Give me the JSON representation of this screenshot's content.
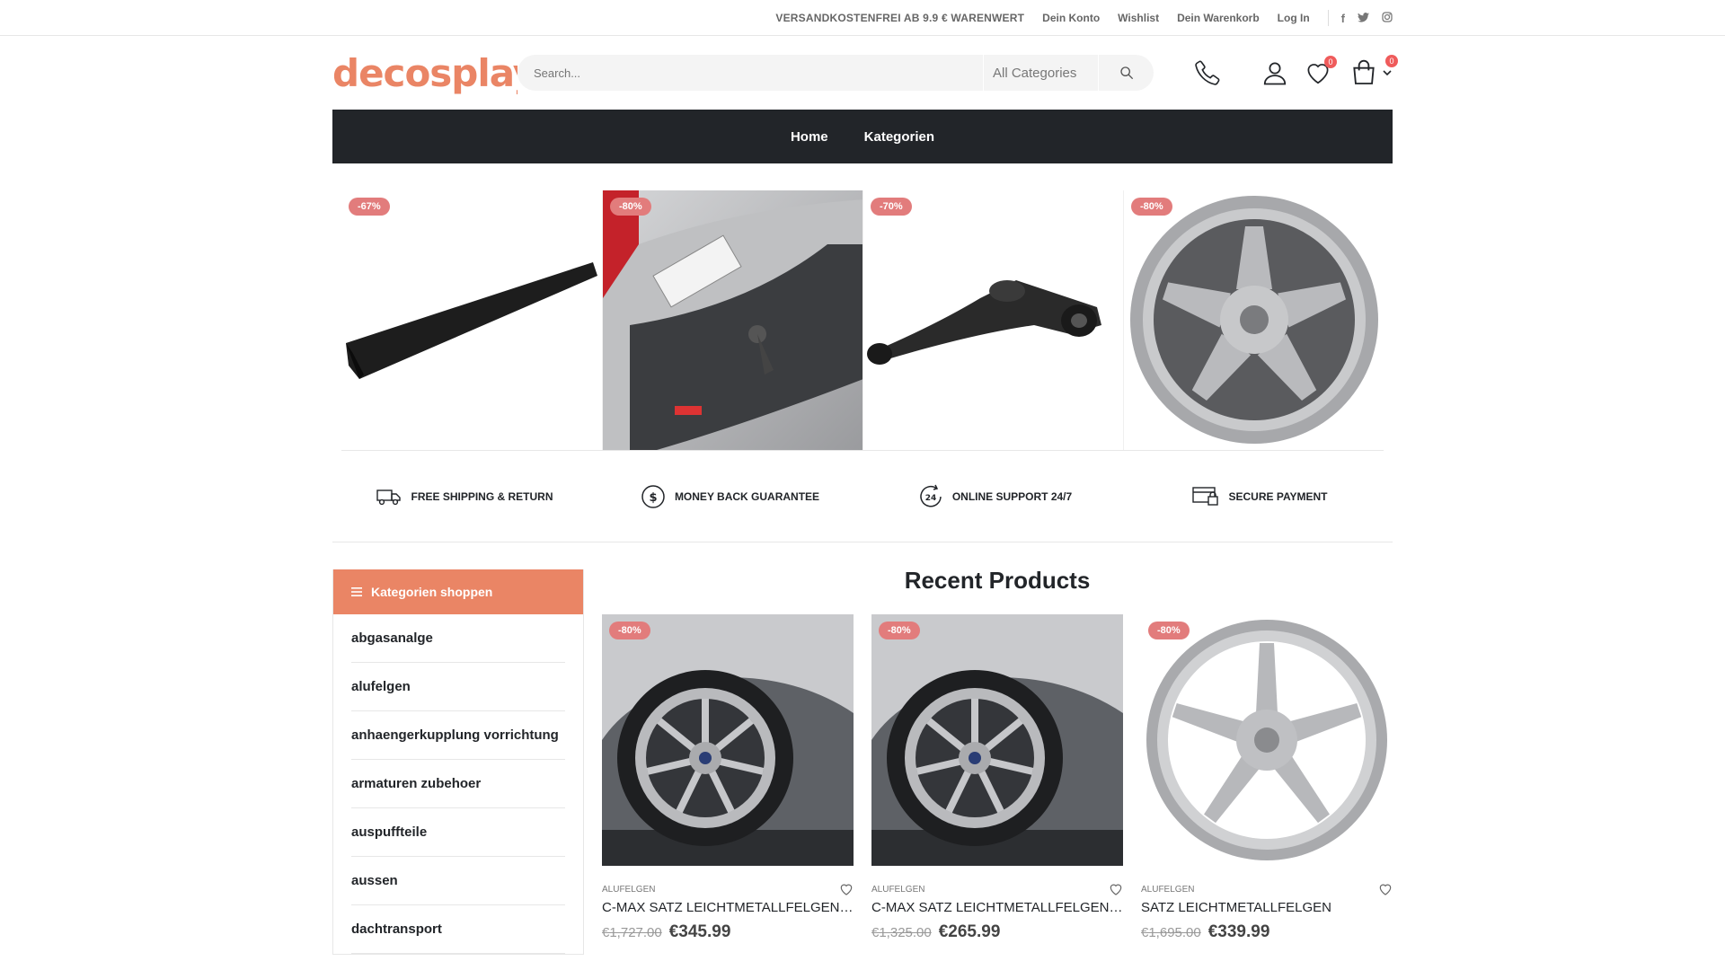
{
  "topbar": {
    "promo": "VERSANDKOSTENFREI AB 9.9 € WARENWERT",
    "links": [
      "Dein Konto",
      "Wishlist",
      "Dein Warenkorb",
      "Log In"
    ]
  },
  "header": {
    "logo": "decosplaycom",
    "search_placeholder": "Search...",
    "category_select": "All Categories",
    "wishlist_count": "0",
    "cart_count": "0"
  },
  "nav": {
    "items": [
      "Home",
      "Kategorien"
    ]
  },
  "banner": {
    "items": [
      {
        "discount": "-67%"
      },
      {
        "discount": "-80%"
      },
      {
        "discount": "-70%"
      },
      {
        "discount": "-80%"
      }
    ]
  },
  "features": [
    "FREE SHIPPING & RETURN",
    "MONEY BACK GUARANTEE",
    "ONLINE SUPPORT 24/7",
    "SECURE PAYMENT"
  ],
  "sidebar": {
    "title": "Kategorien shoppen",
    "items": [
      "abgasanalge",
      "alufelgen",
      "anhaengerkupplung vorrichtung",
      "armaturen zubehoer",
      "auspuffteile",
      "aussen",
      "dachtransport"
    ]
  },
  "products": {
    "title": "Recent Products",
    "items": [
      {
        "discount": "-80%",
        "category": "ALUFELGEN",
        "name": "C-MAX SATZ LEICHTMETALLFELGEN A...",
        "old_price": "€1,727.00",
        "price": "€345.99"
      },
      {
        "discount": "-80%",
        "category": "ALUFELGEN",
        "name": "C-MAX SATZ LEICHTMETALLFELGEN A...",
        "old_price": "€1,325.00",
        "price": "€265.99"
      },
      {
        "discount": "-80%",
        "category": "ALUFELGEN",
        "name": "SATZ LEICHTMETALLFELGEN",
        "old_price": "€1,695.00",
        "price": "€339.99"
      }
    ]
  },
  "colors": {
    "accent": "#ea8565",
    "sale": "#e27c7c",
    "dark": "#222529"
  }
}
